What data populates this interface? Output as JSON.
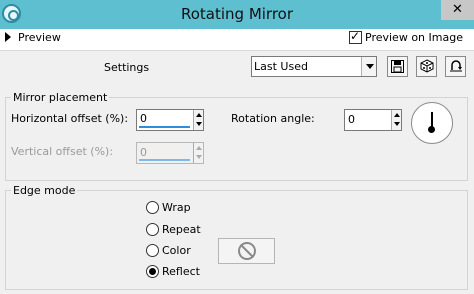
{
  "window": {
    "title": "Rotating Mirror"
  },
  "preview_bar": {
    "label": "Preview",
    "preview_on_image_label": "Preview on Image",
    "preview_on_image_checked": true
  },
  "settings": {
    "label": "Settings",
    "preset_value": "Last Used"
  },
  "toolbar": {
    "icons": [
      "save-preset-icon",
      "randomize-icon",
      "reset-icon"
    ]
  },
  "mirror_placement": {
    "title": "Mirror placement",
    "horizontal_offset_label": "Horizontal offset (%):",
    "horizontal_offset_value": "0",
    "vertical_offset_label": "Vertical offset (%):",
    "vertical_offset_value": "0",
    "rotation_angle_label": "Rotation angle:",
    "rotation_angle_value": "0"
  },
  "edge_mode": {
    "title": "Edge mode",
    "options": [
      {
        "label": "Wrap",
        "selected": false
      },
      {
        "label": "Repeat",
        "selected": false
      },
      {
        "label": "Color",
        "selected": false
      },
      {
        "label": "Reflect",
        "selected": true
      }
    ]
  },
  "colors": {
    "title_bar": "#5ebfd0",
    "accent_underline": "#2d8ee0"
  }
}
